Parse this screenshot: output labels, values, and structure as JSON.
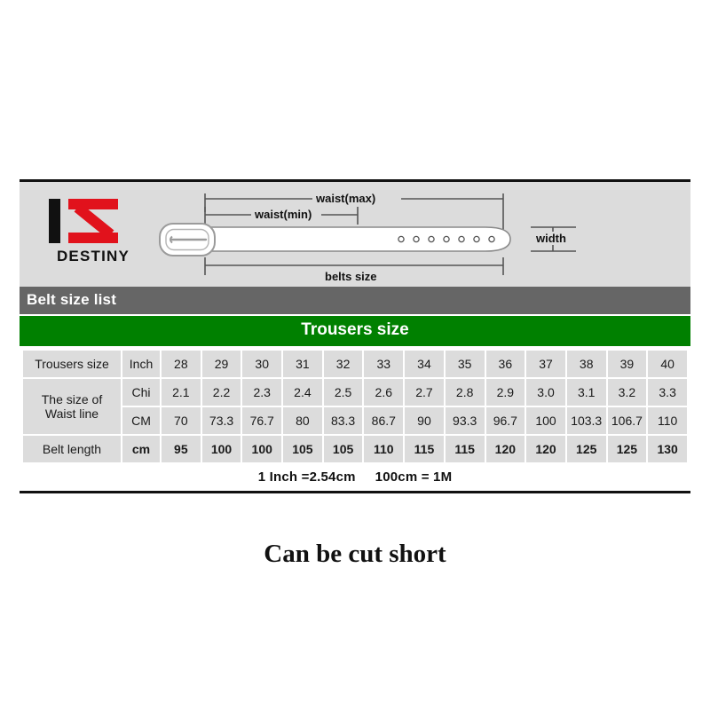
{
  "brand": {
    "logo_name": "destiny-logo",
    "wordmark": "DESTINY"
  },
  "diagram": {
    "labels": {
      "waist_max": "waist(max)",
      "waist_min": "waist(min)",
      "belts_size": "belts size",
      "width": "width"
    },
    "holes": 7
  },
  "headers": {
    "grey_bar": "Belt size list",
    "green_bar": "Trousers size"
  },
  "colors": {
    "grey_bar": "#666666",
    "green_bar": "#008000",
    "cell": "#dcdcdc",
    "accent_red": "#ee0000",
    "logo_red": "#e1121c",
    "panel_bg": "#dcdcdc"
  },
  "table": {
    "rows": [
      {
        "head": "Trousers size",
        "unit": "Inch",
        "values": [
          "28",
          "29",
          "30",
          "31",
          "32",
          "33",
          "34",
          "35",
          "36",
          "37",
          "38",
          "39",
          "40"
        ]
      },
      {
        "head": "The size of",
        "unit": "Chi",
        "values": [
          "2.1",
          "2.2",
          "2.3",
          "2.4",
          "2.5",
          "2.6",
          "2.7",
          "2.8",
          "2.9",
          "3.0",
          "3.1",
          "3.2",
          "3.3"
        ]
      },
      {
        "head": "Waist line",
        "unit": "CM",
        "values": [
          "70",
          "73.3",
          "76.7",
          "80",
          "83.3",
          "86.7",
          "90",
          "93.3",
          "96.7",
          "100",
          "103.3",
          "106.7",
          "110"
        ]
      },
      {
        "head": "Belt length",
        "unit": "cm",
        "values": [
          "95",
          "100",
          "100",
          "105",
          "105",
          "110",
          "115",
          "115",
          "120",
          "120",
          "125",
          "125",
          "130"
        ]
      }
    ]
  },
  "conversion": {
    "inch": "1 Inch =2.54cm",
    "metre": "100cm = 1M"
  },
  "footer": {
    "note": "Can be cut short"
  }
}
